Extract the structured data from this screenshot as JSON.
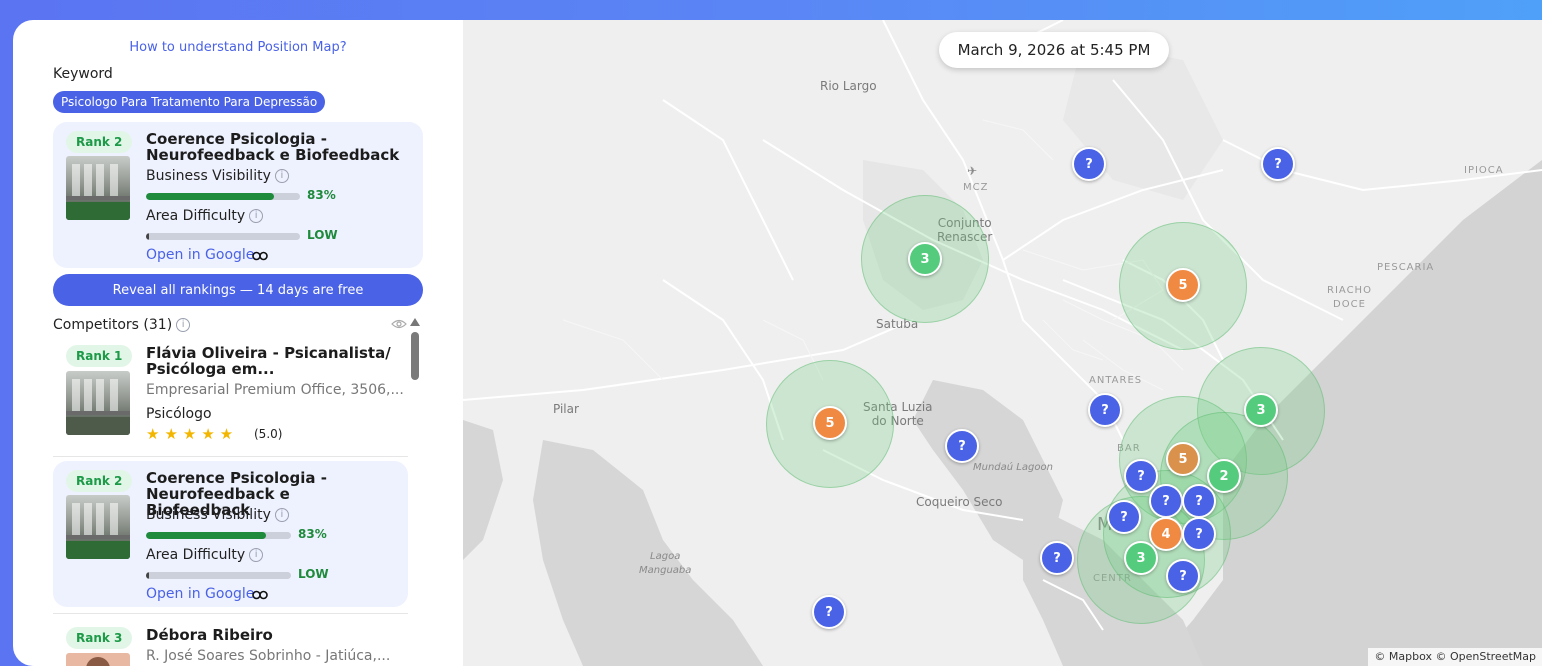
{
  "panel": {
    "help_link": "How to understand Position Map?",
    "keyword_label": "Keyword",
    "keyword": "Psicologo Para Tratamento Para Depressão",
    "reveal_button": "Reveal all rankings — 14 days are free",
    "competitors_label": "Competitors (31)"
  },
  "my_business": {
    "rank": "Rank 2",
    "name": "Coerence Psicologia - Neurofeedback e Biofeedback",
    "visibility_label": "Business Visibility",
    "visibility_value": "83%",
    "visibility_fraction": 0.83,
    "difficulty_label": "Area Difficulty",
    "difficulty_value": "LOW",
    "difficulty_fraction": 0.02,
    "google_link": "Open in Google"
  },
  "competitors": [
    {
      "rank": "Rank 1",
      "name": "Flávia Oliveira - Psicanalista/ Psicóloga em...",
      "address": "Empresarial Premium Office, 3506,...",
      "category": "Psicólogo",
      "stars": "★★★★★",
      "rating": "(5.0)"
    },
    {
      "rank": "Rank 2",
      "name": "Coerence Psicologia - Neurofeedback e Biofeedback",
      "visibility_label": "Business Visibility",
      "visibility_value": "83%",
      "visibility_fraction": 0.83,
      "difficulty_label": "Area Difficulty",
      "difficulty_value": "LOW",
      "difficulty_fraction": 0.02,
      "google_link": "Open in Google"
    },
    {
      "rank": "Rank 3",
      "name": "Débora Ribeiro",
      "address": "R. José Soares Sobrinho - Jatiúca,..."
    }
  ],
  "map": {
    "timestamp": "March 9, 2026 at 5:45 PM",
    "attribution": "© Mapbox © OpenStreetMap",
    "places": {
      "rio_largo": "Rio Largo",
      "mcz": "MCZ",
      "conjunto": "Conjunto\nRenascer",
      "satuba": "Satuba",
      "antares": "ANTARES",
      "pilar": "Pilar",
      "santa_luzia": "Santa Luzia\ndo Norte",
      "mundau": "Mundaú Lagoon",
      "coqueiro": "Coqueiro Seco",
      "lagoa": "Lagoa\nManguaba",
      "ipioca": "IPIOCA",
      "pescaria": "PESCARIA",
      "riacho": "RIACHO\nDOCE",
      "barro": "BAR",
      "maceio": "M",
      "centro": "CENTR"
    },
    "pins": {
      "q": "?",
      "p1": "3",
      "p2": "5",
      "p3": "5",
      "p4": "3",
      "p5": "5",
      "p6": "2",
      "p7": "4",
      "p8": "3"
    }
  },
  "colors": {
    "accent": "#4a62e6",
    "rank_green": "#1d9a48",
    "bar_green": "#1e8a3c",
    "pin_blue": "#4a62e6",
    "pin_green": "#55cc7d",
    "pin_orange": "#f08a43"
  },
  "icons": [
    "info-icon",
    "link-icon",
    "eye-icon",
    "scroll-up-icon",
    "star-icon",
    "airport-icon"
  ]
}
